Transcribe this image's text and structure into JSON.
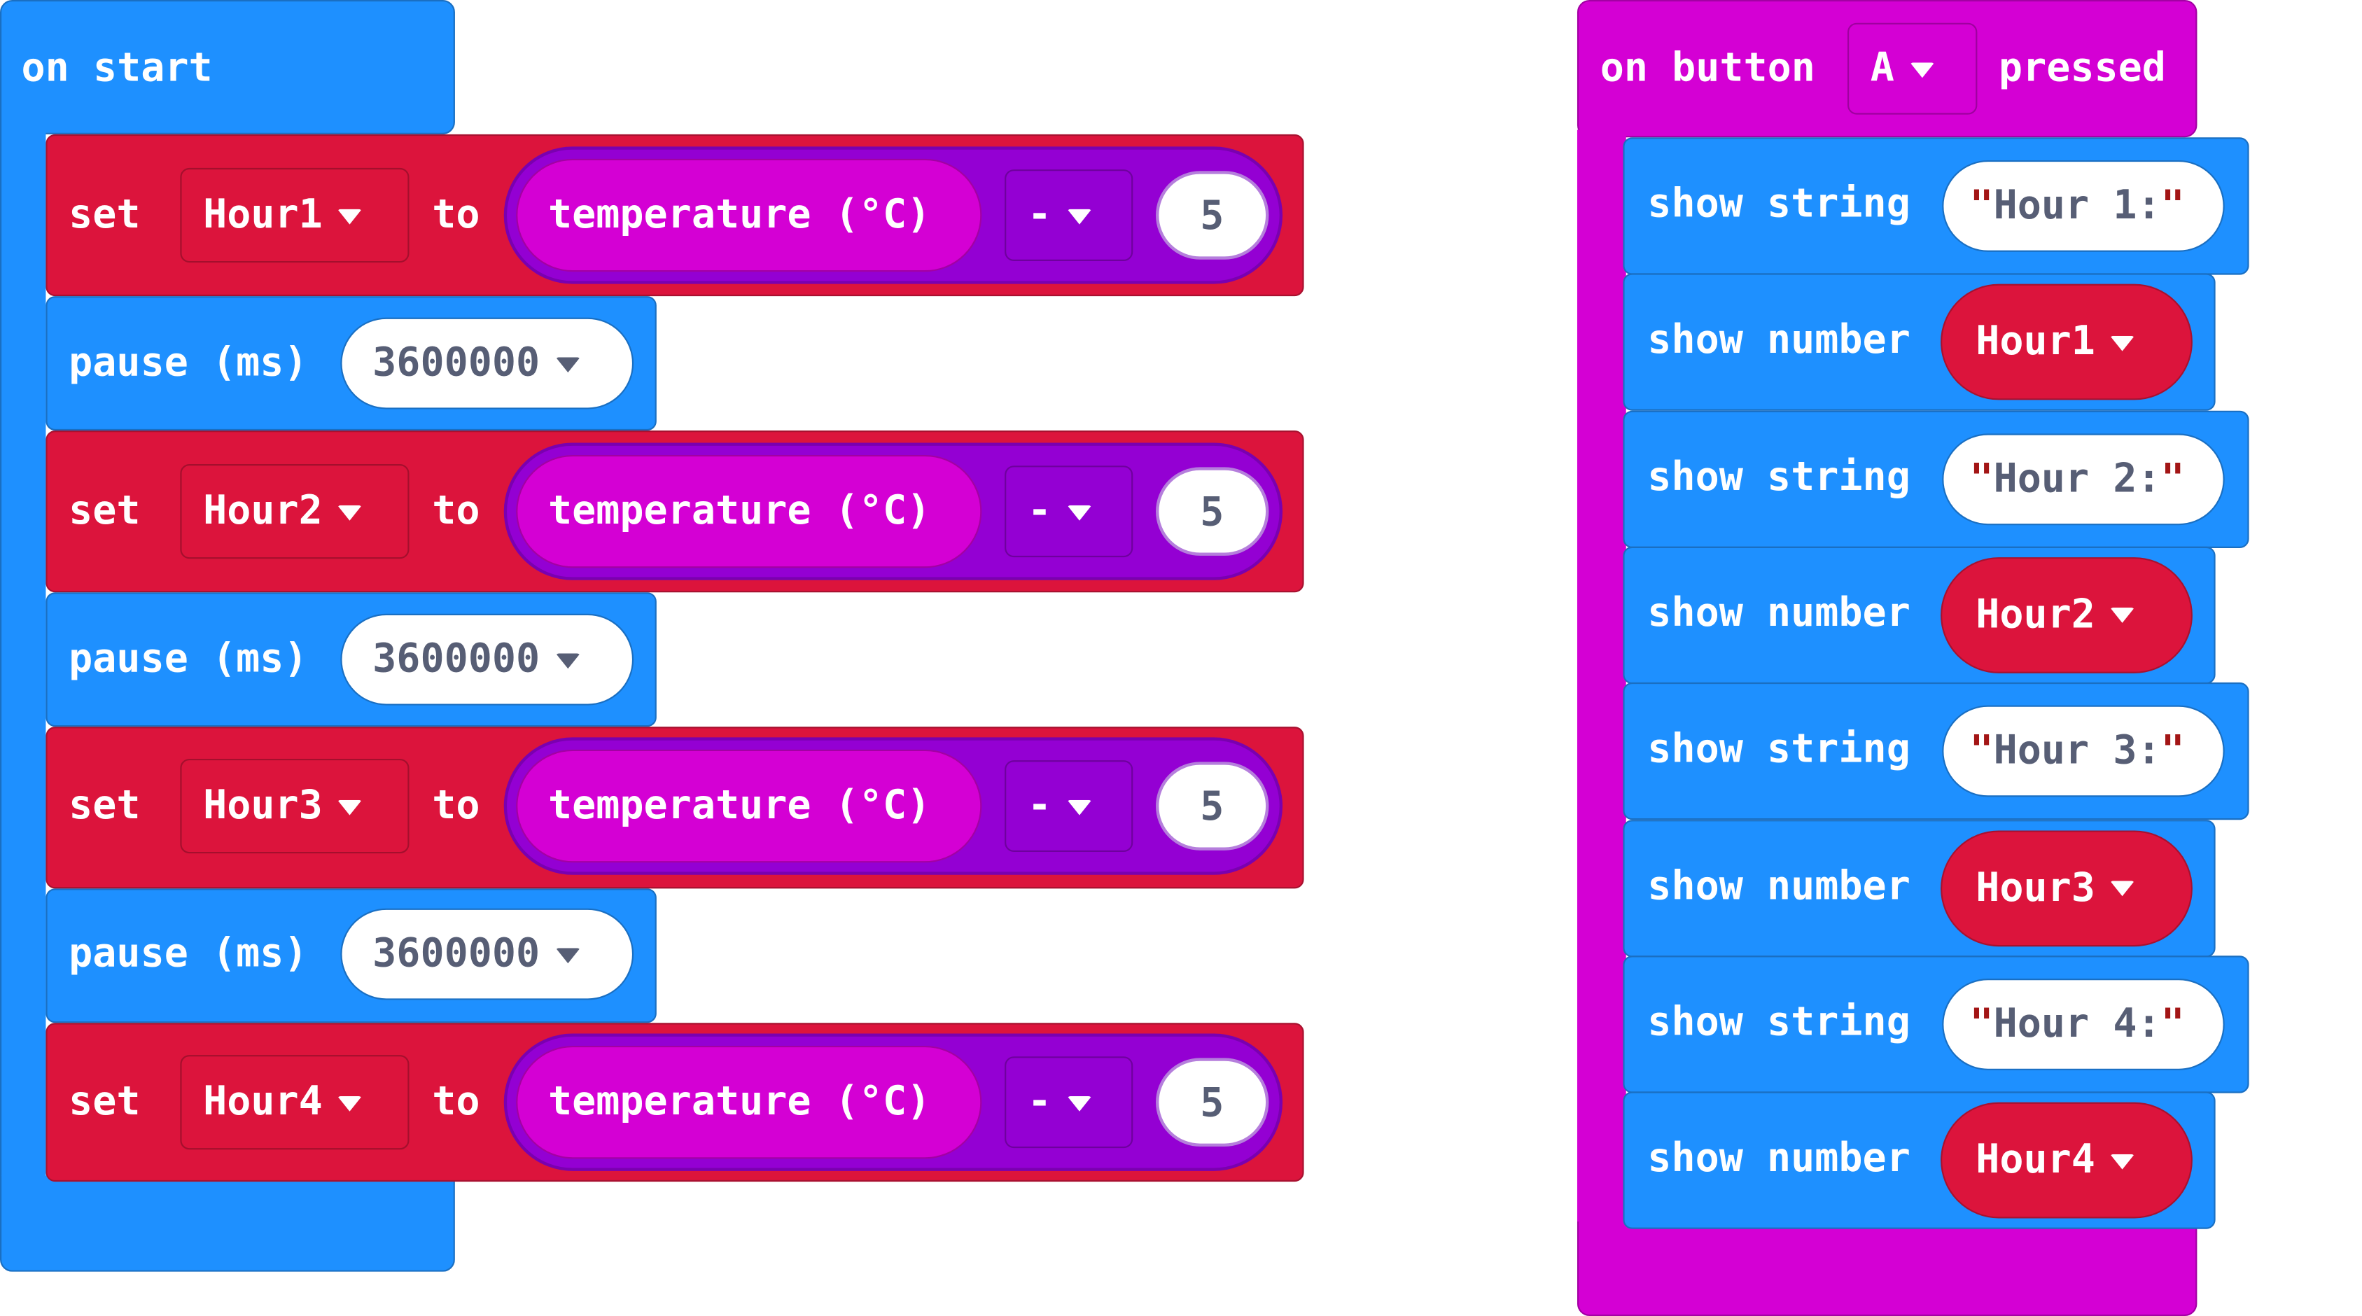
{
  "on_start": {
    "label": "on start",
    "statements": [
      {
        "type": "set",
        "set_label": "set",
        "variable": "Hour1",
        "to_label": "to",
        "sensor": "temperature (°C)",
        "operator": "-",
        "operand": "5"
      },
      {
        "type": "pause",
        "label": "pause (ms)",
        "value": "3600000"
      },
      {
        "type": "set",
        "set_label": "set",
        "variable": "Hour2",
        "to_label": "to",
        "sensor": "temperature (°C)",
        "operator": "-",
        "operand": "5"
      },
      {
        "type": "pause",
        "label": "pause (ms)",
        "value": "3600000"
      },
      {
        "type": "set",
        "set_label": "set",
        "variable": "Hour3",
        "to_label": "to",
        "sensor": "temperature (°C)",
        "operator": "-",
        "operand": "5"
      },
      {
        "type": "pause",
        "label": "pause (ms)",
        "value": "3600000"
      },
      {
        "type": "set",
        "set_label": "set",
        "variable": "Hour4",
        "to_label": "to",
        "sensor": "temperature (°C)",
        "operator": "-",
        "operand": "5"
      }
    ]
  },
  "on_button": {
    "label_prefix": "on button",
    "button": "A",
    "label_suffix": "pressed",
    "statements": [
      {
        "type": "string",
        "label": "show string",
        "value": "Hour 1:"
      },
      {
        "type": "number",
        "label": "show number",
        "variable": "Hour1"
      },
      {
        "type": "string",
        "label": "show string",
        "value": "Hour 2:"
      },
      {
        "type": "number",
        "label": "show number",
        "variable": "Hour2"
      },
      {
        "type": "string",
        "label": "show string",
        "value": "Hour 3:"
      },
      {
        "type": "number",
        "label": "show number",
        "variable": "Hour3"
      },
      {
        "type": "string",
        "label": "show string",
        "value": "Hour 4:"
      },
      {
        "type": "number",
        "label": "show number",
        "variable": "Hour4"
      }
    ]
  },
  "colors": {
    "basic": "#1e90ff",
    "variables": "#dc143c",
    "input": "#d400d4",
    "math": "#9400d3"
  }
}
